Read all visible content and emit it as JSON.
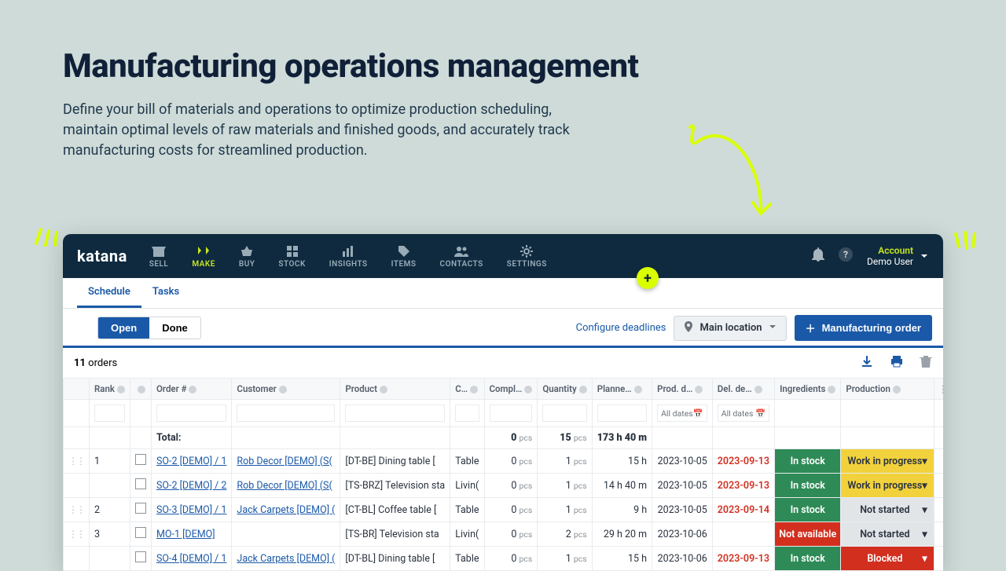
{
  "hero": {
    "title": "Manufacturing operations management",
    "description": "Define your bill of materials and operations to optimize production scheduling, maintain optimal levels of raw materials and finished goods, and accurately track manufacturing costs for streamlined production."
  },
  "brand": "katana",
  "nav": {
    "sell": "SELL",
    "make": "MAKE",
    "buy": "BUY",
    "stock": "STOCK",
    "insights": "INSIGHTS",
    "items": "ITEMS",
    "contacts": "CONTACTS",
    "settings": "SETTINGS"
  },
  "account": {
    "label": "Account",
    "user": "Demo User"
  },
  "subtabs": {
    "schedule": "Schedule",
    "tasks": "Tasks"
  },
  "toolbar": {
    "open": "Open",
    "done": "Done",
    "configure_deadlines": "Configure deadlines",
    "location": "Main location",
    "new_order": "Manufacturing order"
  },
  "meta": {
    "count": "11",
    "count_label": "orders"
  },
  "columns": {
    "rank": "Rank",
    "order": "Order #",
    "customer": "Customer",
    "product": "Product",
    "c": "C…",
    "completed": "Compl…",
    "quantity": "Quantity",
    "planned": "Planne…",
    "prod_date": "Prod. d…",
    "del_date": "Del. de…",
    "ingredients": "Ingredients",
    "production": "Production"
  },
  "filters": {
    "all_dates": "All dates"
  },
  "totals": {
    "label": "Total:",
    "completed": "0",
    "quantity": "15",
    "planned": "173 h 40 m"
  },
  "units": {
    "pcs": "pcs"
  },
  "status": {
    "in_stock": "In stock",
    "not_available": "Not available",
    "wip": "Work in progress",
    "not_started": "Not started",
    "blocked": "Blocked"
  },
  "rows": [
    {
      "rank": "1",
      "order": "SO-2 [DEMO] / 1",
      "customer": "Rob Decor [DEMO] (S(",
      "product": "[DT-BE] Dining table [",
      "c": "Table",
      "compl": "0",
      "qty": "1",
      "plan": "15 h",
      "pdate": "2023-10-05",
      "ddate": "2023-09-13",
      "ing": "in_stock",
      "pstat": "wip",
      "group_first": true
    },
    {
      "rank": "",
      "order": "SO-2 [DEMO] / 2",
      "customer": "Rob Decor [DEMO] (S(",
      "product": "[TS-BRZ] Television sta",
      "c": "Livin(",
      "compl": "0",
      "qty": "1",
      "plan": "14 h 40 m",
      "pdate": "2023-10-05",
      "ddate": "2023-09-13",
      "ing": "in_stock",
      "pstat": "wip",
      "group_first": false
    },
    {
      "rank": "2",
      "order": "SO-3 [DEMO] / 1",
      "customer": "Jack Carpets [DEMO] (",
      "product": "[CT-BL] Coffee table [",
      "c": "Table",
      "compl": "0",
      "qty": "1",
      "plan": "9 h",
      "pdate": "2023-10-05",
      "ddate": "2023-09-14",
      "ing": "in_stock",
      "pstat": "not_started",
      "group_first": true
    },
    {
      "rank": "3",
      "order": "MO-1 [DEMO]",
      "customer": "",
      "product": "[TS-BR] Television sta",
      "c": "Livin(",
      "compl": "0",
      "qty": "2",
      "plan": "29 h 20 m",
      "pdate": "2023-10-06",
      "ddate": "",
      "ing": "not_available",
      "pstat": "not_started",
      "group_first": true
    },
    {
      "rank": "",
      "order": "SO-4 [DEMO] / 1",
      "customer": "Jack Carpets [DEMO] (",
      "product": "[DT-BL] Dining table [",
      "c": "Table",
      "compl": "0",
      "qty": "1",
      "plan": "15 h",
      "pdate": "2023-10-06",
      "ddate": "2023-09-13",
      "ing": "in_stock",
      "pstat": "blocked",
      "group_first": false
    }
  ]
}
